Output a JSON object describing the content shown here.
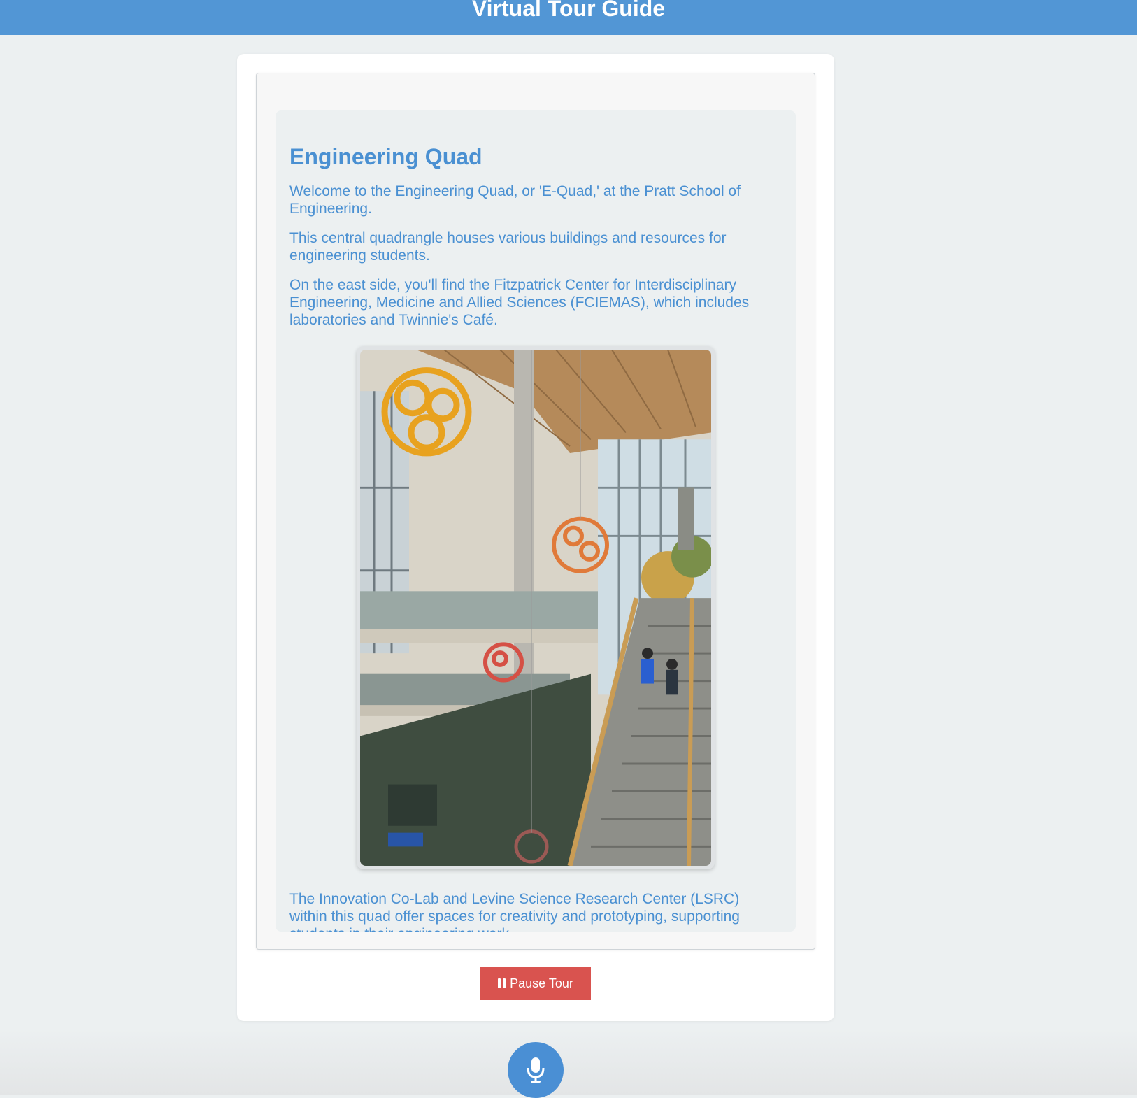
{
  "header": {
    "title": "Virtual Tour Guide"
  },
  "stop": {
    "title": "Engineering Quad",
    "paragraphs": [
      "Welcome to the Engineering Quad, or 'E-Quad,' at the Pratt School of Engineering.",
      "This central quadrangle houses various buildings and resources for engineering students.",
      "On the east side, you'll find the Fitzpatrick Center for Interdisciplinary Engineering, Medicine and Allied Sciences (FCIEMAS), which includes laboratories and Twinnie's Café.",
      "The Innovation Co-Lab and Levine Science Research Center (LSRC) within this quad offer spaces for creativity and prototyping, supporting students in their engineering work."
    ],
    "image_icon": "atrium-photo"
  },
  "controls": {
    "pause_label": "Pause Tour",
    "pause_icon": "pause-icon",
    "mic_icon": "microphone-icon"
  },
  "colors": {
    "header_bg": "#5296d5",
    "accent_text": "#4a90d2",
    "pause_button": "#d9534f",
    "mic_button": "#4a8fd4"
  }
}
